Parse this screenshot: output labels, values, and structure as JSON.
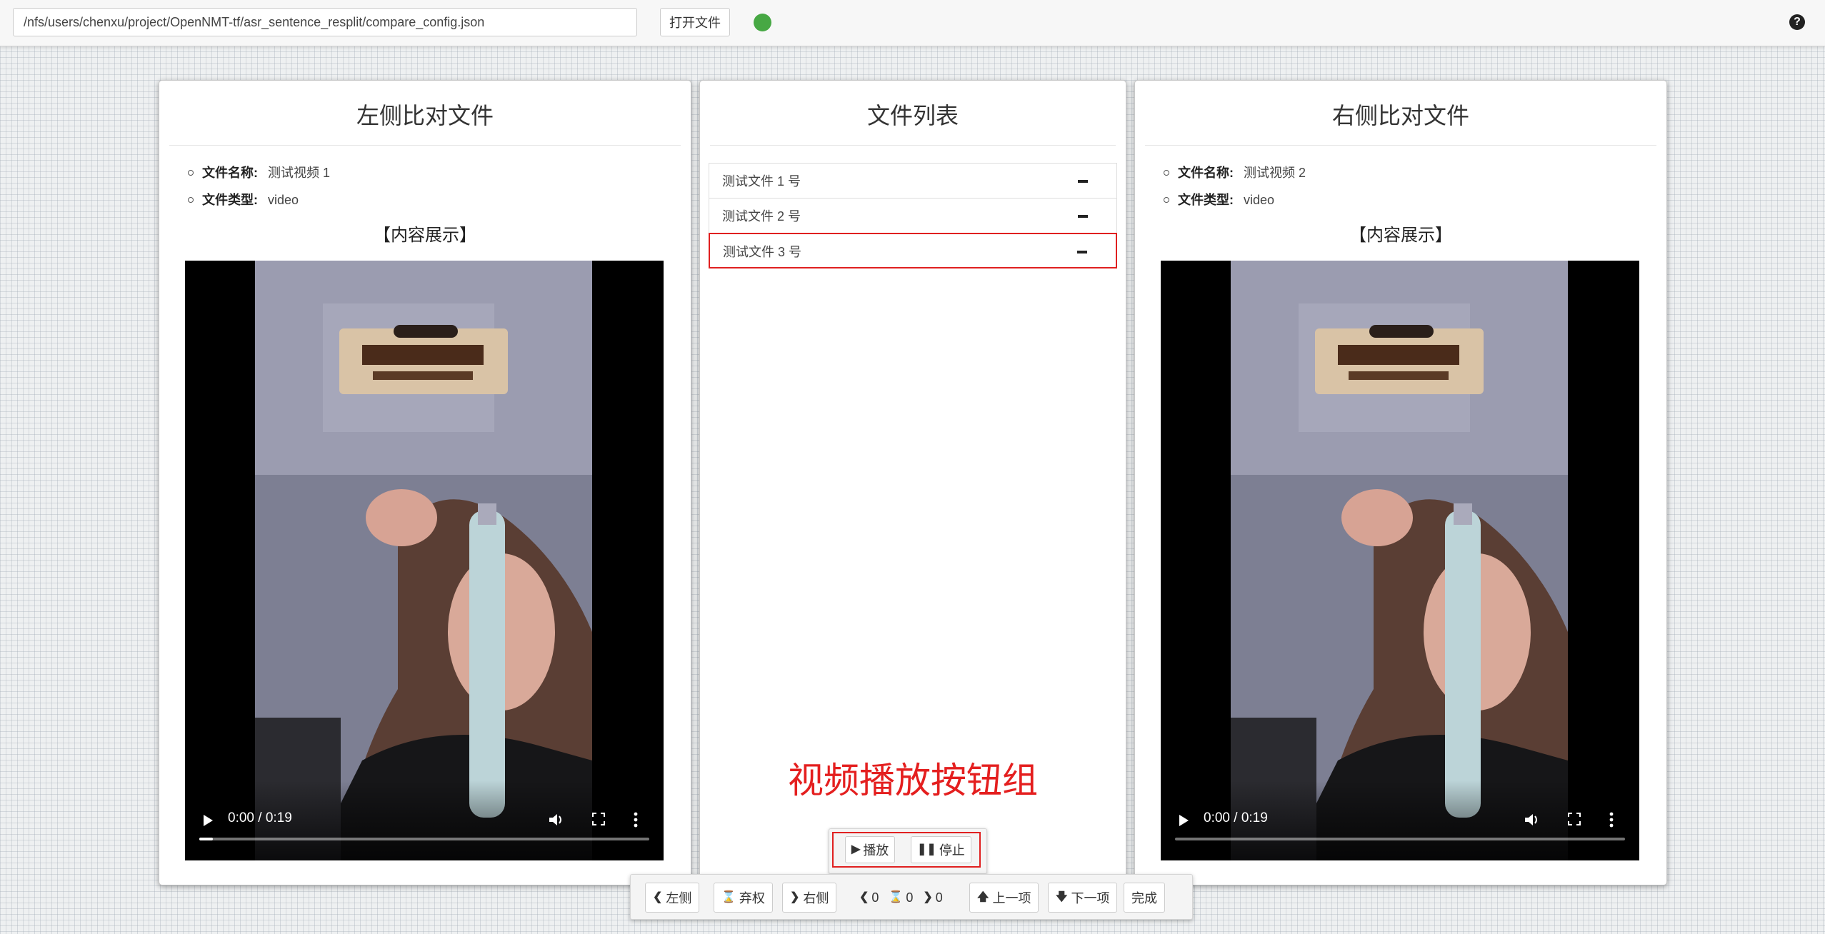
{
  "topbar": {
    "path_value": "/nfs/users/chenxu/project/OpenNMT-tf/asr_sentence_resplit/compare_config.json",
    "open_button": "打开文件",
    "status_color": "#47a844",
    "help_icon": "question-circle-icon"
  },
  "left_panel": {
    "title": "左侧比对文件",
    "name_label": "文件名称:",
    "name_value": "测试视频 1",
    "type_label": "文件类型:",
    "type_value": "video",
    "content_label": "【内容展示】",
    "video": {
      "time": "0:00 / 0:19",
      "progress": 0.03
    }
  },
  "middle_panel": {
    "title": "文件列表",
    "files": [
      {
        "name": "测试文件 1 号",
        "selected": false
      },
      {
        "name": "测试文件 2 号",
        "selected": false
      },
      {
        "name": "测试文件 3 号",
        "selected": true
      }
    ],
    "annotation": "视频播放按钮组",
    "play_button": "播放",
    "stop_button": "停止"
  },
  "right_panel": {
    "title": "右侧比对文件",
    "name_label": "文件名称:",
    "name_value": "测试视频 2",
    "type_label": "文件类型:",
    "type_value": "video",
    "content_label": "【内容展示】",
    "video": {
      "time": "0:00 / 0:19",
      "progress": 0
    }
  },
  "toolbar": {
    "left_button": "左侧",
    "abstain_button": "弃权",
    "right_button": "右侧",
    "left_count": "0",
    "abstain_count": "0",
    "right_count": "0",
    "prev_button": "上一项",
    "next_button": "下一项",
    "done_button": "完成"
  },
  "colors": {
    "highlight": "#e02020",
    "annotation": "#e41f1f"
  }
}
